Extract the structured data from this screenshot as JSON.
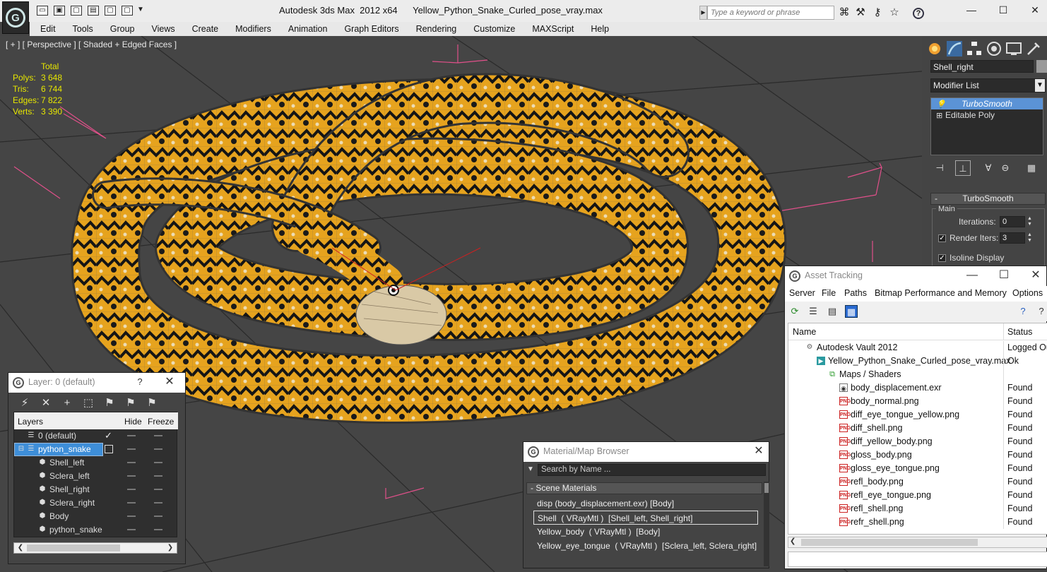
{
  "title_bar": {
    "title": "Autodesk 3ds Max  2012 x64      Yellow_Python_Snake_Curled_pose_vray.max",
    "search_placeholder": "Type a keyword or phrase",
    "help_glyph": "?"
  },
  "menu": {
    "items": [
      "Edit",
      "Tools",
      "Group",
      "Views",
      "Create",
      "Modifiers",
      "Animation",
      "Graph Editors",
      "Rendering",
      "Customize",
      "MAXScript",
      "Help"
    ]
  },
  "viewport": {
    "label": "[ + ] [ Perspective ] [ Shaded + Edged Faces ]",
    "stats": {
      "header": "Total",
      "rows": [
        {
          "key": "Polys:",
          "value": "3 648"
        },
        {
          "key": "Tris:",
          "value": "6 744"
        },
        {
          "key": "Edges:",
          "value": "7 822"
        },
        {
          "key": "Verts:",
          "value": "3 390"
        }
      ]
    }
  },
  "command_panel": {
    "object_name": "Shell_right",
    "modifier_list": "Modifier List",
    "stack": [
      {
        "label": "TurboSmooth",
        "selected": true
      },
      {
        "label": "Editable Poly",
        "selected": false
      }
    ],
    "rollout": {
      "title": "TurboSmooth",
      "group": "Main",
      "iterations_label": "Iterations:",
      "iterations_value": "0",
      "render_iters_label": "Render Iters:",
      "render_iters_value": "3",
      "isoline_label": "Isoline Display"
    }
  },
  "layer_dialog": {
    "title": "Layer: 0 (default)",
    "help": "?",
    "columns": {
      "layers": "Layers",
      "hide": "Hide",
      "freeze": "Freeze"
    },
    "rows": [
      {
        "name": "0 (default)",
        "level": 0,
        "selected": false
      },
      {
        "name": "python_snake",
        "level": 0,
        "selected": true
      },
      {
        "name": "Shell_left",
        "level": 1,
        "selected": false
      },
      {
        "name": "Sclera_left",
        "level": 1,
        "selected": false
      },
      {
        "name": "Shell_right",
        "level": 1,
        "selected": false
      },
      {
        "name": "Sclera_right",
        "level": 1,
        "selected": false
      },
      {
        "name": "Body",
        "level": 1,
        "selected": false
      },
      {
        "name": "python_snake",
        "level": 1,
        "selected": false
      }
    ]
  },
  "material_browser": {
    "title": "Material/Map Browser",
    "search_placeholder": "Search by Name ...",
    "section": "Scene Materials",
    "items": [
      {
        "label": "disp (body_displacement.exr) [Body]",
        "selected": false
      },
      {
        "label": "Shell  ( VRayMtl )  [Shell_left, Shell_right]",
        "selected": true
      },
      {
        "label": "Yellow_body  ( VRayMtl )  [Body]",
        "selected": false
      },
      {
        "label": "Yellow_eye_tongue  ( VRayMtl )  [Sclera_left, Sclera_right]",
        "selected": false
      }
    ]
  },
  "asset_tracking": {
    "title": "Asset Tracking",
    "menu": [
      "Server",
      "File",
      "Paths",
      "Bitmap Performance and Memory",
      "Options"
    ],
    "columns": {
      "name": "Name",
      "status": "Status"
    },
    "rows": [
      {
        "name": "Autodesk Vault 2012",
        "status": "Logged Ou",
        "level": 0,
        "icon": "vault-icon"
      },
      {
        "name": "Yellow_Python_Snake_Curled_pose_vray.max",
        "status": "Ok",
        "level": 1,
        "icon": "max-file-icon"
      },
      {
        "name": "Maps / Shaders",
        "status": "",
        "level": 2,
        "icon": "maps-folder-icon"
      },
      {
        "name": "body_displacement.exr",
        "status": "Found",
        "level": 3,
        "icon": "exr-file-icon"
      },
      {
        "name": "body_normal.png",
        "status": "Found",
        "level": 3,
        "icon": "png-file-icon"
      },
      {
        "name": "diff_eye_tongue_yellow.png",
        "status": "Found",
        "level": 3,
        "icon": "png-file-icon"
      },
      {
        "name": "diff_shell.png",
        "status": "Found",
        "level": 3,
        "icon": "png-file-icon"
      },
      {
        "name": "diff_yellow_body.png",
        "status": "Found",
        "level": 3,
        "icon": "png-file-icon"
      },
      {
        "name": "gloss_body.png",
        "status": "Found",
        "level": 3,
        "icon": "png-file-icon"
      },
      {
        "name": "gloss_eye_tongue.png",
        "status": "Found",
        "level": 3,
        "icon": "png-file-icon"
      },
      {
        "name": "refl_body.png",
        "status": "Found",
        "level": 3,
        "icon": "png-file-icon"
      },
      {
        "name": "refl_eye_tongue.png",
        "status": "Found",
        "level": 3,
        "icon": "png-file-icon"
      },
      {
        "name": "refl_shell.png",
        "status": "Found",
        "level": 3,
        "icon": "png-file-icon"
      },
      {
        "name": "refr_shell.png",
        "status": "Found",
        "level": 3,
        "icon": "png-file-icon"
      }
    ]
  },
  "colors": {
    "selection": "#5b93d6",
    "stats_text": "#e6e600",
    "snake_yellow": "#e8a41c",
    "grid_pink": "#e0508a"
  },
  "icons": {
    "png_badge": "PNG"
  }
}
